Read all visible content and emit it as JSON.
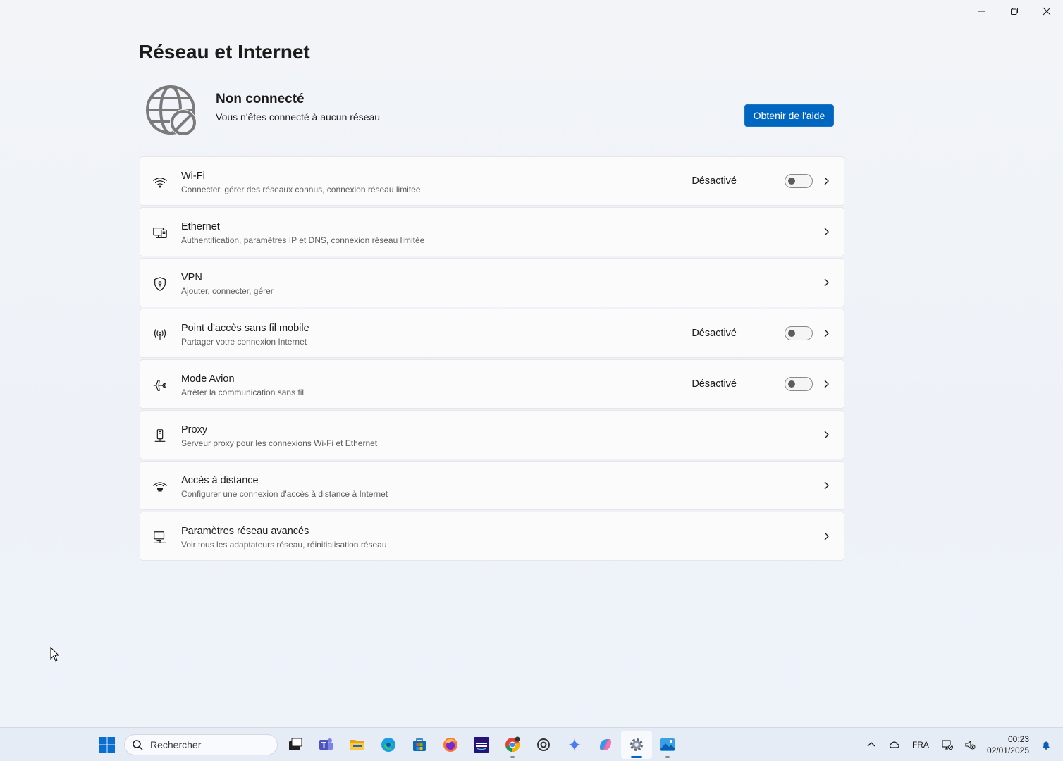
{
  "window": {
    "controls": [
      "minimize",
      "restore",
      "close"
    ]
  },
  "page": {
    "title": "Réseau et Internet"
  },
  "status": {
    "title": "Non connecté",
    "subtitle": "Vous n'êtes connecté à aucun réseau",
    "help_button": "Obtenir de l'aide"
  },
  "items": [
    {
      "icon": "wifi-icon",
      "title": "Wi-Fi",
      "desc": "Connecter, gérer des réseaux connus, connexion réseau limitée",
      "state": "Désactivé",
      "toggle": false
    },
    {
      "icon": "ethernet-icon",
      "title": "Ethernet",
      "desc": "Authentification, paramètres IP et DNS, connexion réseau limitée"
    },
    {
      "icon": "vpn-shield-icon",
      "title": "VPN",
      "desc": "Ajouter, connecter, gérer"
    },
    {
      "icon": "hotspot-icon",
      "title": "Point d'accès sans fil mobile",
      "desc": "Partager votre connexion Internet",
      "state": "Désactivé",
      "toggle": false
    },
    {
      "icon": "airplane-icon",
      "title": "Mode Avion",
      "desc": "Arrêter la communication sans fil",
      "state": "Désactivé",
      "toggle": false
    },
    {
      "icon": "proxy-icon",
      "title": "Proxy",
      "desc": "Serveur proxy pour les connexions Wi-Fi et Ethernet"
    },
    {
      "icon": "dialup-icon",
      "title": "Accès à distance",
      "desc": "Configurer une connexion d'accès à distance à Internet"
    },
    {
      "icon": "advanced-network-icon",
      "title": "Paramètres réseau avancés",
      "desc": "Voir tous les adaptateurs réseau, réinitialisation réseau"
    }
  ],
  "taskbar": {
    "search_placeholder": "Rechercher",
    "apps": [
      "task-view",
      "teams",
      "file-explorer",
      "edge",
      "store",
      "firefox",
      "amazon-music",
      "chrome",
      "chatgpt",
      "gemini",
      "copilot",
      "settings",
      "photos"
    ],
    "tray": {
      "language": "FRA",
      "time": "00:23",
      "date": "02/01/2025"
    }
  }
}
